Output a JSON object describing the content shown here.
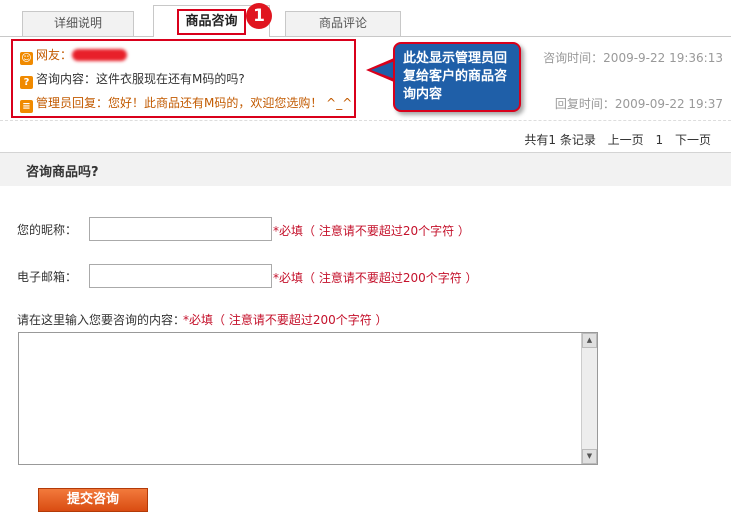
{
  "tabs": [
    {
      "label": "详细说明"
    },
    {
      "label": "商品咨询"
    },
    {
      "label": "商品评论"
    }
  ],
  "step_number": "1",
  "consultation": {
    "user_label": "网友：",
    "question_label": "咨询内容：",
    "question_text": "这件衣服现在还有M码的吗?",
    "reply_label": "管理员回复：",
    "reply_text": "您好！此商品还有M码的，欢迎您选购！  ^_^",
    "consult_time": "咨询时间：2009-9-22 19:36:13",
    "reply_time": "回复时间：2009-09-22 19:37"
  },
  "callout_text": "此处显示管理员回复给客户的商品咨询内容",
  "pager": {
    "count": "共有1 条记录",
    "prev": "上一页",
    "page": "1",
    "next": "下一页"
  },
  "form": {
    "section_title": "咨询商品吗?",
    "nickname_label": "您的昵称：",
    "email_label": "电子邮箱：",
    "content_label": "请在这里输入您要咨询的内容：",
    "req_nickname": "*必填（ 注意请不要超过20个字符 ）",
    "req_email": "*必填（ 注意请不要超过200个字符 ）",
    "req_content": "*必填（ 注意请不要超过200个字符 ）",
    "submit_label": "提交咨询"
  },
  "colors": {
    "accent_red": "#d9001b",
    "callout_blue": "#1f5fa8",
    "reply_orange": "#c25a00",
    "submit_orange": "#e0601f"
  }
}
